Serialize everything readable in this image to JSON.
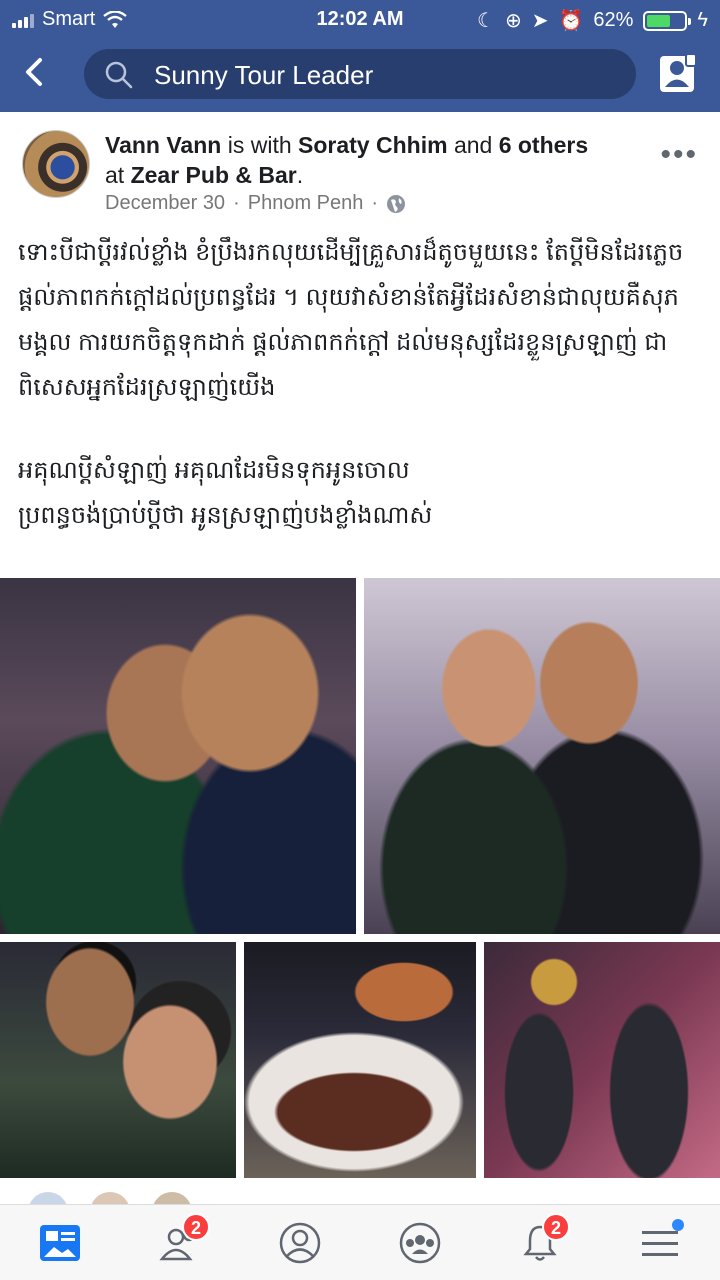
{
  "status_bar": {
    "carrier": "Smart",
    "time": "12:02 AM",
    "battery_percent": "62%",
    "battery_level": 0.62
  },
  "nav": {
    "back_icon": "chevron-left-icon",
    "search_text": "Sunny Tour Leader",
    "profile_icon": "profile-card-icon"
  },
  "post": {
    "author": "Vann Vann",
    "with_text": "is with",
    "tagged": "Soraty Chhim",
    "and_text": "and",
    "others": "6 others",
    "at_text": "at",
    "place": "Zear Pub & Bar",
    "date": "December 30",
    "location": "Phnom Penh",
    "privacy_icon": "globe-icon",
    "paragraphs": [
      "ទោះបីជាប្ដីរវល់់ខ្លាំង ខំប្រឹងរកលុយដើម្បីគ្រួសារដ៏តូចមួយនេះ តែប្ដីមិនដែរភ្លេចផ្ដល់ភាពកក់ក្ដៅដល់ប្រពន្ធដែរ ។ លុយវាសំខាន់តែអ្វីដែរសំខាន់ជាលុយគឺសុភមង្គល ការយកចិត្តទុកដាក់ ផ្ដល់ភាពកក់ក្ដៅ ដល់មនុស្សដែរខ្លួនស្រឡាញ់ ជាពិសេសអ្នកដែរស្រឡាញ់យើង",
      "អគុណប្ដីសំឡាញ់ អគុណដែរមិនទុកអូនចោល",
      "ប្រពន្ធចង់ប្រាប់ប្ដីថា អូនស្រឡាញ់បងខ្លាំងណាស់"
    ]
  },
  "tabbar": {
    "items": [
      {
        "name": "news-feed",
        "icon": "news-feed-icon",
        "badge": ""
      },
      {
        "name": "friend-requests",
        "icon": "friends-icon",
        "badge": "2"
      },
      {
        "name": "profile",
        "icon": "profile-icon",
        "badge": ""
      },
      {
        "name": "groups",
        "icon": "groups-icon",
        "badge": ""
      },
      {
        "name": "notifications",
        "icon": "bell-icon",
        "badge": "2"
      },
      {
        "name": "menu",
        "icon": "menu-icon",
        "badge": ""
      }
    ]
  },
  "colors": {
    "brand": "#3b5998",
    "badge": "#fa3e3e",
    "active_tab": "#1877f2"
  }
}
